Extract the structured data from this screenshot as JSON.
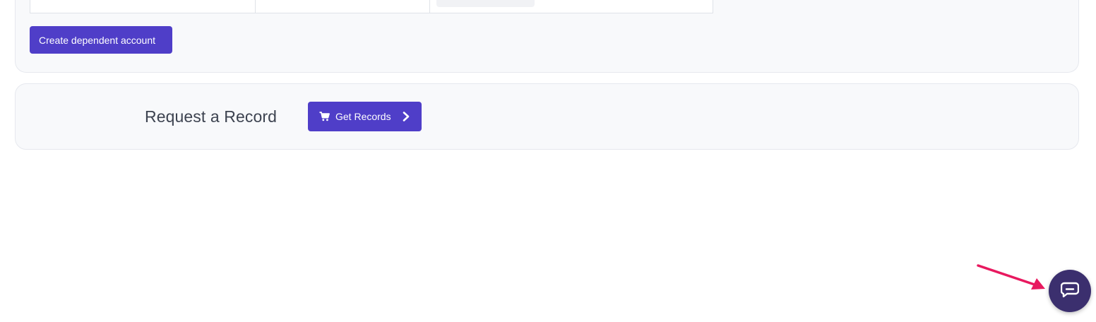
{
  "dependents": {
    "create_button_label": "Create dependent account"
  },
  "request_record": {
    "title": "Request a Record",
    "button_label": "Get Records",
    "button_icon": "cart-icon",
    "button_trailing_icon": "chevron-right-icon"
  },
  "chat": {
    "icon": "chat-bubble-icon"
  },
  "colors": {
    "primary": "#4f3ec8",
    "chat_bg": "#3b2f6e",
    "annotation_arrow": "#e8195f",
    "card_bg": "#f8f9fb"
  }
}
